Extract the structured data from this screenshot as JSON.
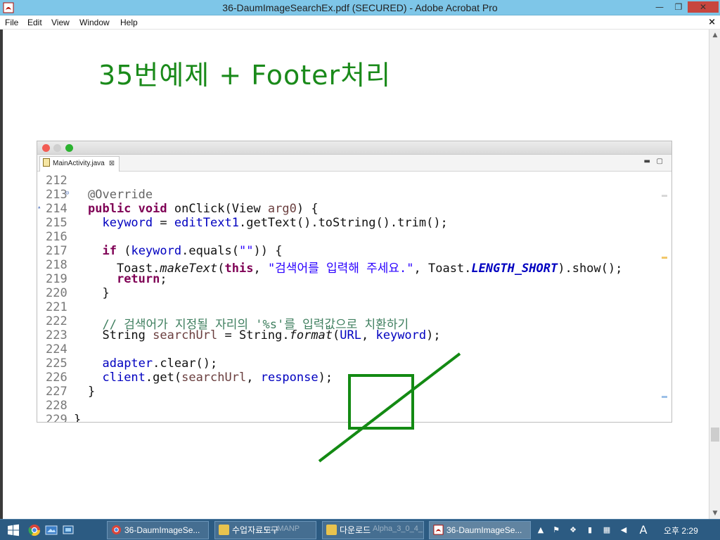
{
  "window": {
    "title": "36-DaumImageSearchEx.pdf (SECURED) - Adobe Acrobat Pro",
    "min_glyph": "—",
    "max_glyph": "❐",
    "close_glyph": "✕"
  },
  "menu": {
    "items": [
      "File",
      "Edit",
      "View",
      "Window",
      "Help"
    ],
    "doc_close_glyph": "×"
  },
  "slide": {
    "title": "35번예제 + Footer처리"
  },
  "editor": {
    "tab_label": "MainActivity.java",
    "tab_close": "⊠",
    "line_numbers": [
      "212",
      "213",
      "214",
      "215",
      "216",
      "217",
      "218",
      "219",
      "220",
      "221",
      "222",
      "223",
      "224",
      "225",
      "226",
      "227",
      "228",
      "229"
    ],
    "colors": {
      "keyword": "#7f0055",
      "field": "#0000c0",
      "string": "#2a00ff",
      "comment": "#3f7f5f",
      "annotation": "#646464"
    }
  },
  "annotation": {
    "color": "#138a13",
    "shape": "square with diagonal strike line"
  },
  "taskbar": {
    "tasks": [
      "36-DaumImageSe...",
      "수업자료도구",
      "다운로드",
      "36-DaumImageSe..."
    ],
    "ghost_texts": [
      "up_MANP",
      "Alpha_3_0_4_"
    ],
    "clock": "오후 2:29",
    "lang": "A"
  }
}
